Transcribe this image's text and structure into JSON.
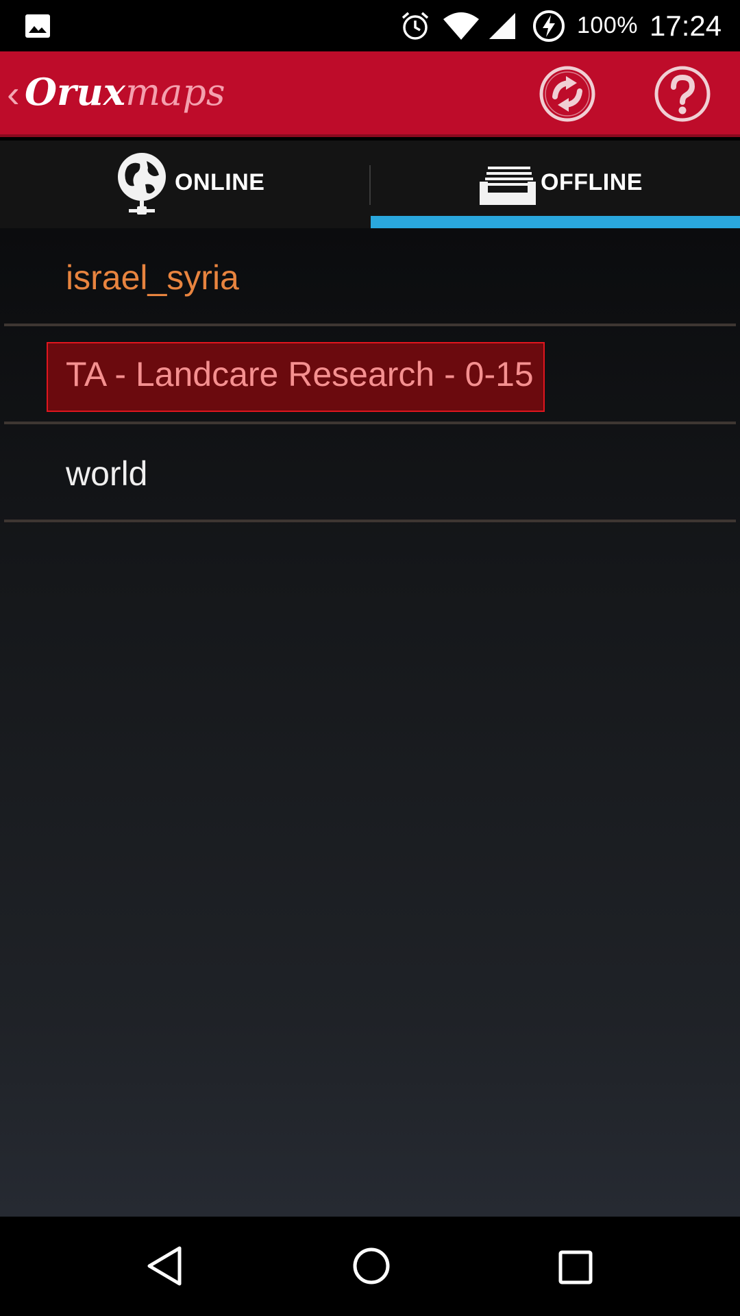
{
  "status_bar": {
    "icons": [
      "gallery-icon",
      "alarm-icon",
      "wifi-icon",
      "signal-icon",
      "battery-charging-icon"
    ],
    "battery": "100%",
    "time": "17:24"
  },
  "action_bar": {
    "logo_part1": "Orux",
    "logo_part2": "maps",
    "actions": [
      "sync-icon",
      "help-icon"
    ],
    "brand_color": "#be0c2a"
  },
  "tabs": [
    {
      "label": "ONLINE",
      "icon": "globe-icon",
      "selected": false
    },
    {
      "label": "OFFLINE",
      "icon": "tray-icon",
      "selected": true
    }
  ],
  "tab_indicator_color": "#2aa7dd",
  "maps": [
    {
      "name": "israel_syria",
      "color": "#e8843f",
      "selected": false
    },
    {
      "name": "TA - Landcare Research - 0-15",
      "color": "#f59090",
      "selected": true
    },
    {
      "name": "world",
      "color": "#efefef",
      "selected": false
    }
  ],
  "nav_bar": [
    "back-icon",
    "home-icon",
    "recents-icon"
  ]
}
